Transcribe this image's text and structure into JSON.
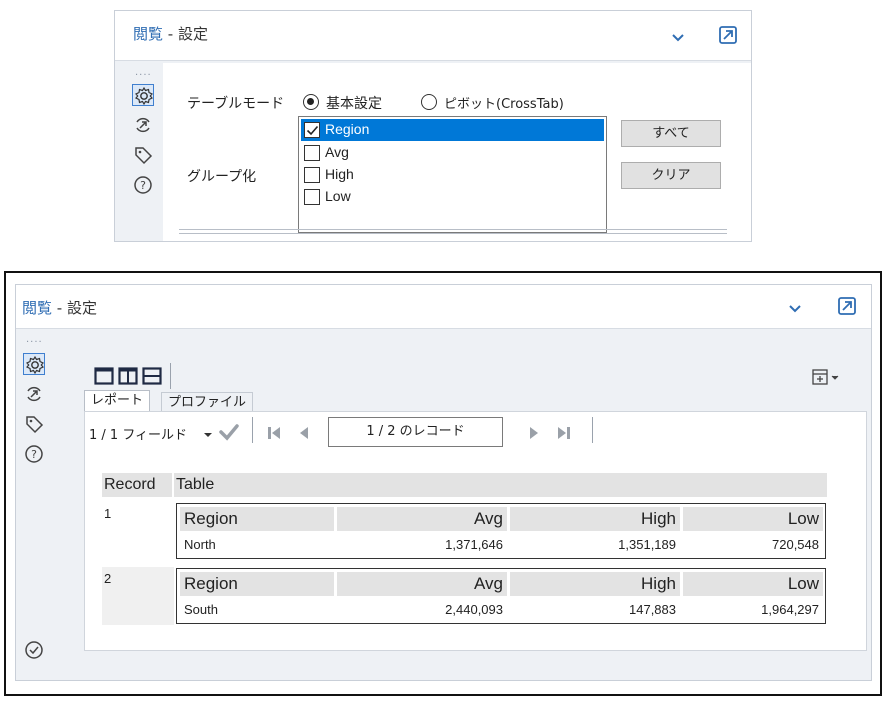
{
  "top_panel": {
    "title_part1": "閲覧",
    "title_part2": " - 設定",
    "dots": "....",
    "table_mode_label": "テーブルモード",
    "mode_options": [
      {
        "label": "基本設定",
        "selected": true
      },
      {
        "label": "ピボット(CrossTab)",
        "selected": false
      }
    ],
    "group_label": "グループ化",
    "group_fields": [
      {
        "label": "Region",
        "checked": true,
        "highlighted": true
      },
      {
        "label": "Avg",
        "checked": false,
        "highlighted": false
      },
      {
        "label": "High",
        "checked": false,
        "highlighted": false
      },
      {
        "label": "Low",
        "checked": false,
        "highlighted": false
      }
    ],
    "select_all_button": "すべて",
    "clear_button": "クリア",
    "cut_off_text": "‥ ‥ ‥"
  },
  "bottom_panel": {
    "title_part1": "閲覧",
    "title_part2": " - 設定",
    "dots": "....",
    "tabs": [
      {
        "label": "レポート",
        "active": true
      },
      {
        "label": "プロファイル",
        "active": false
      }
    ],
    "field_count": "1 / 1 フィールド",
    "record_nav": "1 / 2 のレコード",
    "columns": [
      "Record",
      "Table"
    ],
    "records": [
      {
        "number": "1",
        "headers": [
          "Region",
          "Avg",
          "High",
          "Low"
        ],
        "values": [
          "North",
          "1,371,646",
          "1,351,189",
          "720,548"
        ]
      },
      {
        "number": "2",
        "headers": [
          "Region",
          "Avg",
          "High",
          "Low"
        ],
        "values": [
          "South",
          "2,440,093",
          "147,883",
          "1,964,297"
        ]
      }
    ]
  },
  "colors": {
    "accent": "#2f6db3",
    "selection": "#0078d7",
    "panel_bg": "#eef1f5"
  },
  "icons": [
    "settings-icon",
    "connection-icon",
    "tag-icon",
    "help-icon",
    "chevron-down-icon",
    "expand-icon",
    "checkmark-icon",
    "add-column-icon"
  ]
}
